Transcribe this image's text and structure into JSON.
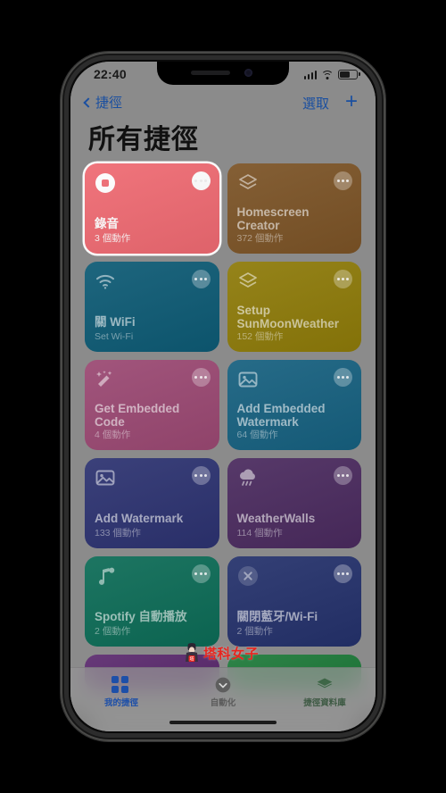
{
  "status_bar": {
    "time": "22:40",
    "cellular_icon": "cellular-bars-icon",
    "wifi_icon": "wifi-icon",
    "battery_icon": "battery-icon",
    "battery_level_pct": 62
  },
  "nav_bar": {
    "back_label": "捷徑",
    "back_icon": "chevron-left-icon",
    "select_label": "選取",
    "add_label": "+",
    "add_icon": "plus-icon"
  },
  "page_title": "所有捷徑",
  "shortcuts": [
    {
      "title": "錄音",
      "subtitle": "3 個動作",
      "color": "#ef6a72",
      "icon": "record-stop-icon",
      "selected": true,
      "two_line": false
    },
    {
      "title": "Homescreen Creator",
      "subtitle": "372 個動作",
      "color": "#7b5326",
      "icon": "layers-icon",
      "selected": false,
      "two_line": true
    },
    {
      "title": "關 WiFi",
      "subtitle": "Set Wi-Fi",
      "color": "#0d5a74",
      "icon": "wifi-icon",
      "selected": false,
      "two_line": false
    },
    {
      "title": "Setup SunMoonWeather",
      "subtitle": "152 個動作",
      "color": "#8d7a09",
      "icon": "layers-icon",
      "selected": false,
      "two_line": true
    },
    {
      "title": "Get Embedded Code",
      "subtitle": "4 個動作",
      "color": "#9a4872",
      "icon": "magic-wand-icon",
      "selected": false,
      "two_line": true
    },
    {
      "title": "Add Embedded Watermark",
      "subtitle": "64 個動作",
      "color": "#16607f",
      "icon": "photo-icon",
      "selected": false,
      "two_line": true
    },
    {
      "title": "Add Watermark",
      "subtitle": "133 個動作",
      "color": "#2c3270",
      "icon": "photo-icon",
      "selected": false,
      "two_line": false
    },
    {
      "title": "WeatherWalls",
      "subtitle": "114 個動作",
      "color": "#4a2a5e",
      "icon": "cloud-rain-icon",
      "selected": false,
      "two_line": false
    },
    {
      "title": "Spotify 自動播放",
      "subtitle": "2 個動作",
      "color": "#0c6b56",
      "icon": "music-note-icon",
      "selected": false,
      "two_line": false
    },
    {
      "title": "關閉藍牙/Wi-Fi",
      "subtitle": "2 個動作",
      "color": "#24316b",
      "icon": "x-circle-icon",
      "selected": false,
      "two_line": false
    }
  ],
  "partial_row": [
    {
      "color": "#5b2a6e"
    },
    {
      "color": "#1e7a3a"
    }
  ],
  "card_more_icon": "ellipsis-icon",
  "watermark": {
    "text": "塔科女子",
    "color": "#e8251f",
    "logo_icon": "mascot-icon"
  },
  "tab_bar": {
    "tabs": [
      {
        "label": "我的捷徑",
        "icon": "grid-icon",
        "active": true
      },
      {
        "label": "自動化",
        "icon": "clock-icon",
        "active": false
      },
      {
        "label": "捷徑資料庫",
        "icon": "layers-icon",
        "active": false
      }
    ]
  },
  "accent_color": "#1d4fa8"
}
